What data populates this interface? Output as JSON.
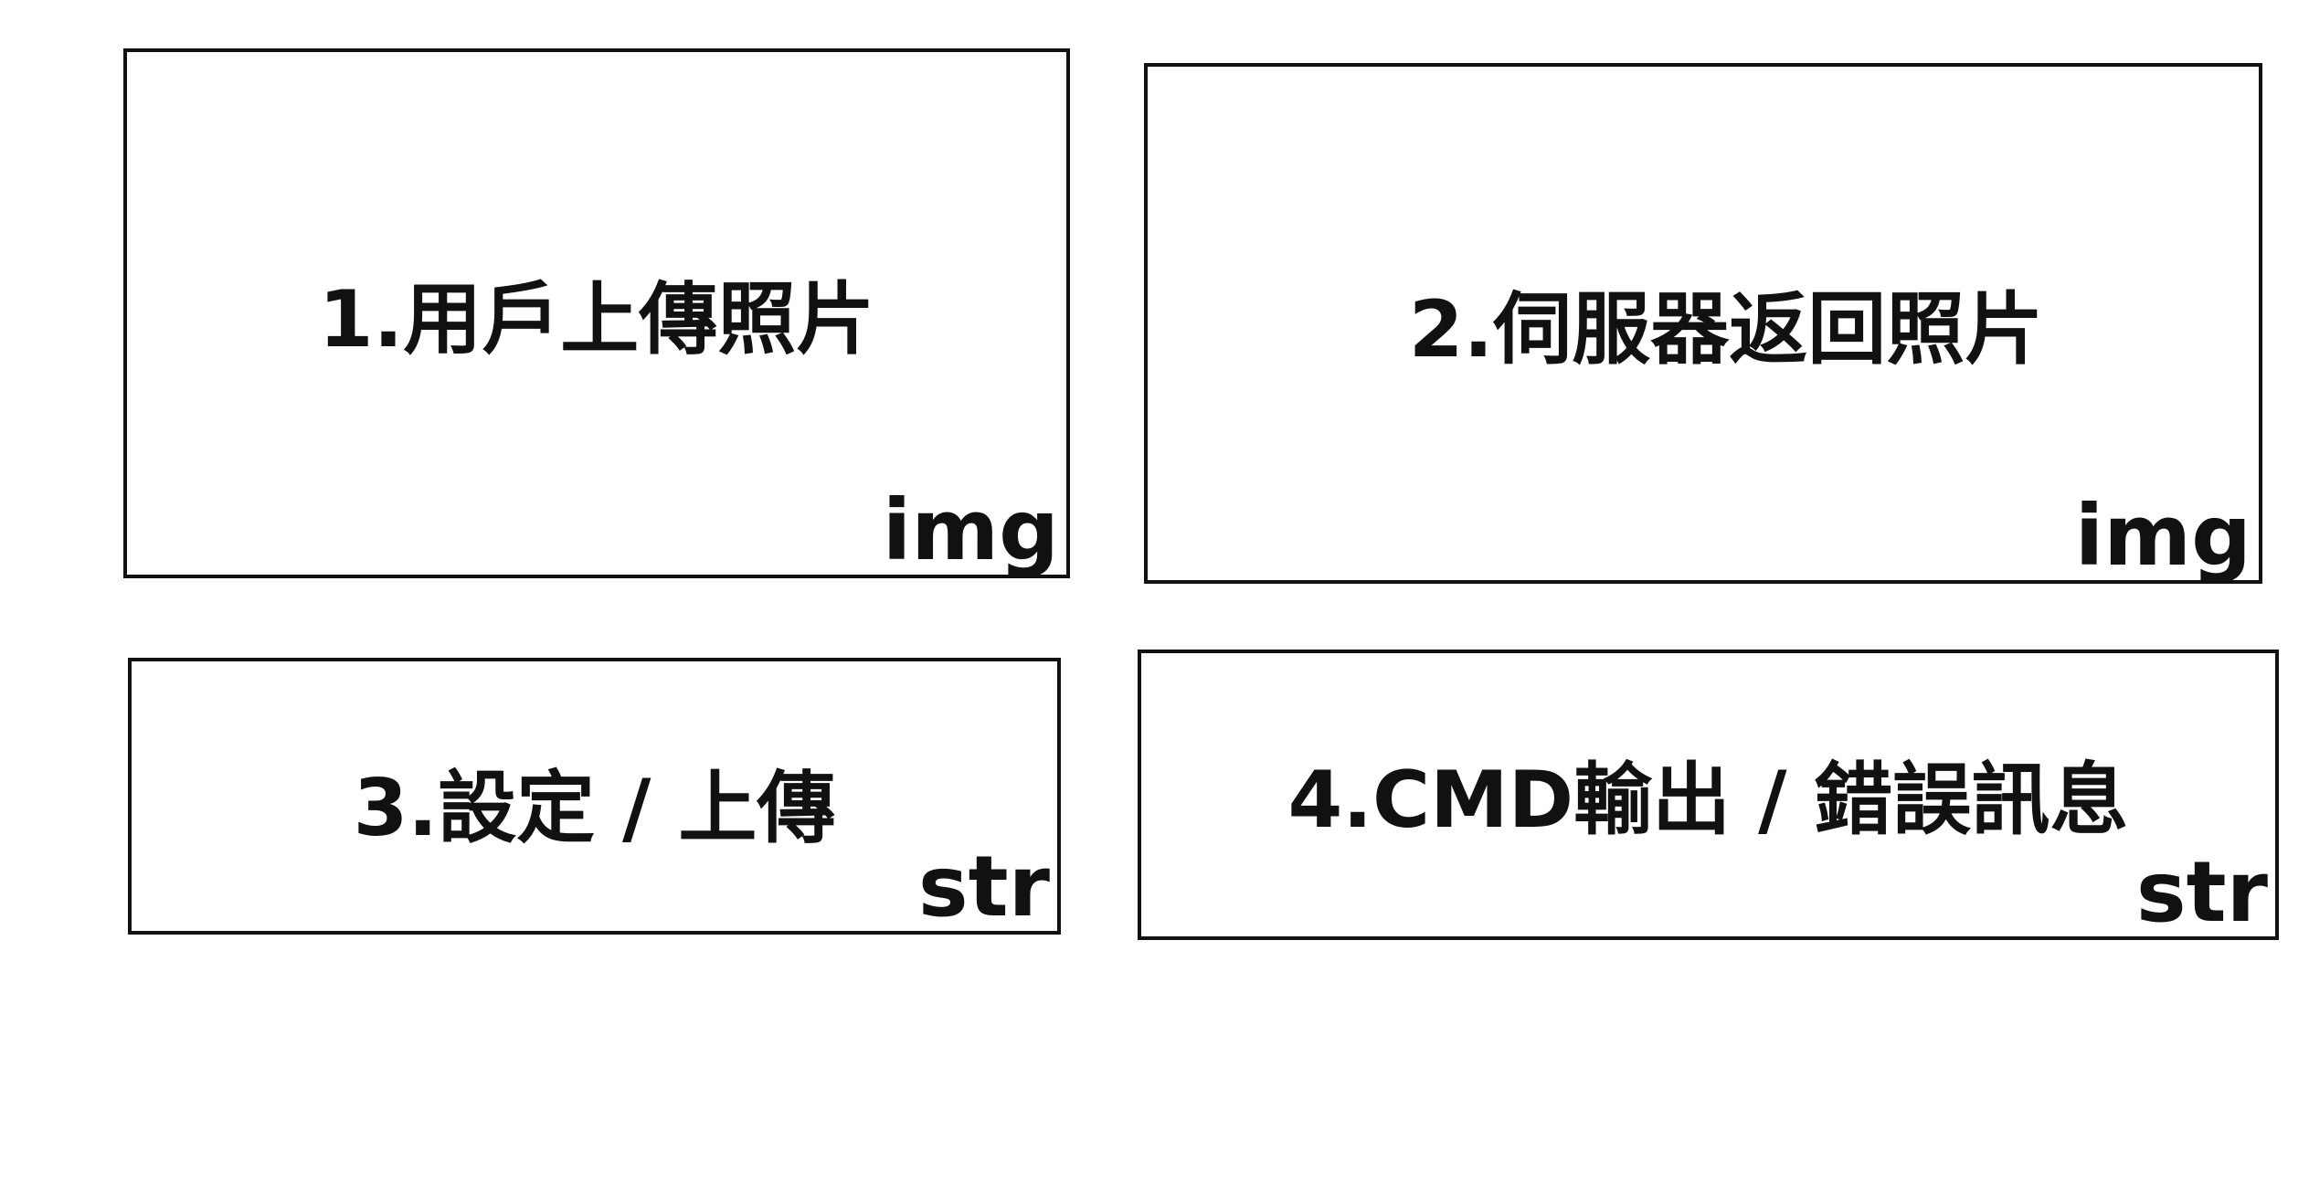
{
  "boxes": [
    {
      "title": "1.用戶上傳照片",
      "type": "img"
    },
    {
      "title": "2.伺服器返回照片",
      "type": "img"
    },
    {
      "title": "3.設定 / 上傳",
      "type": "str"
    },
    {
      "title": "4.CMD輸出 / 錯誤訊息",
      "type": "str"
    }
  ]
}
